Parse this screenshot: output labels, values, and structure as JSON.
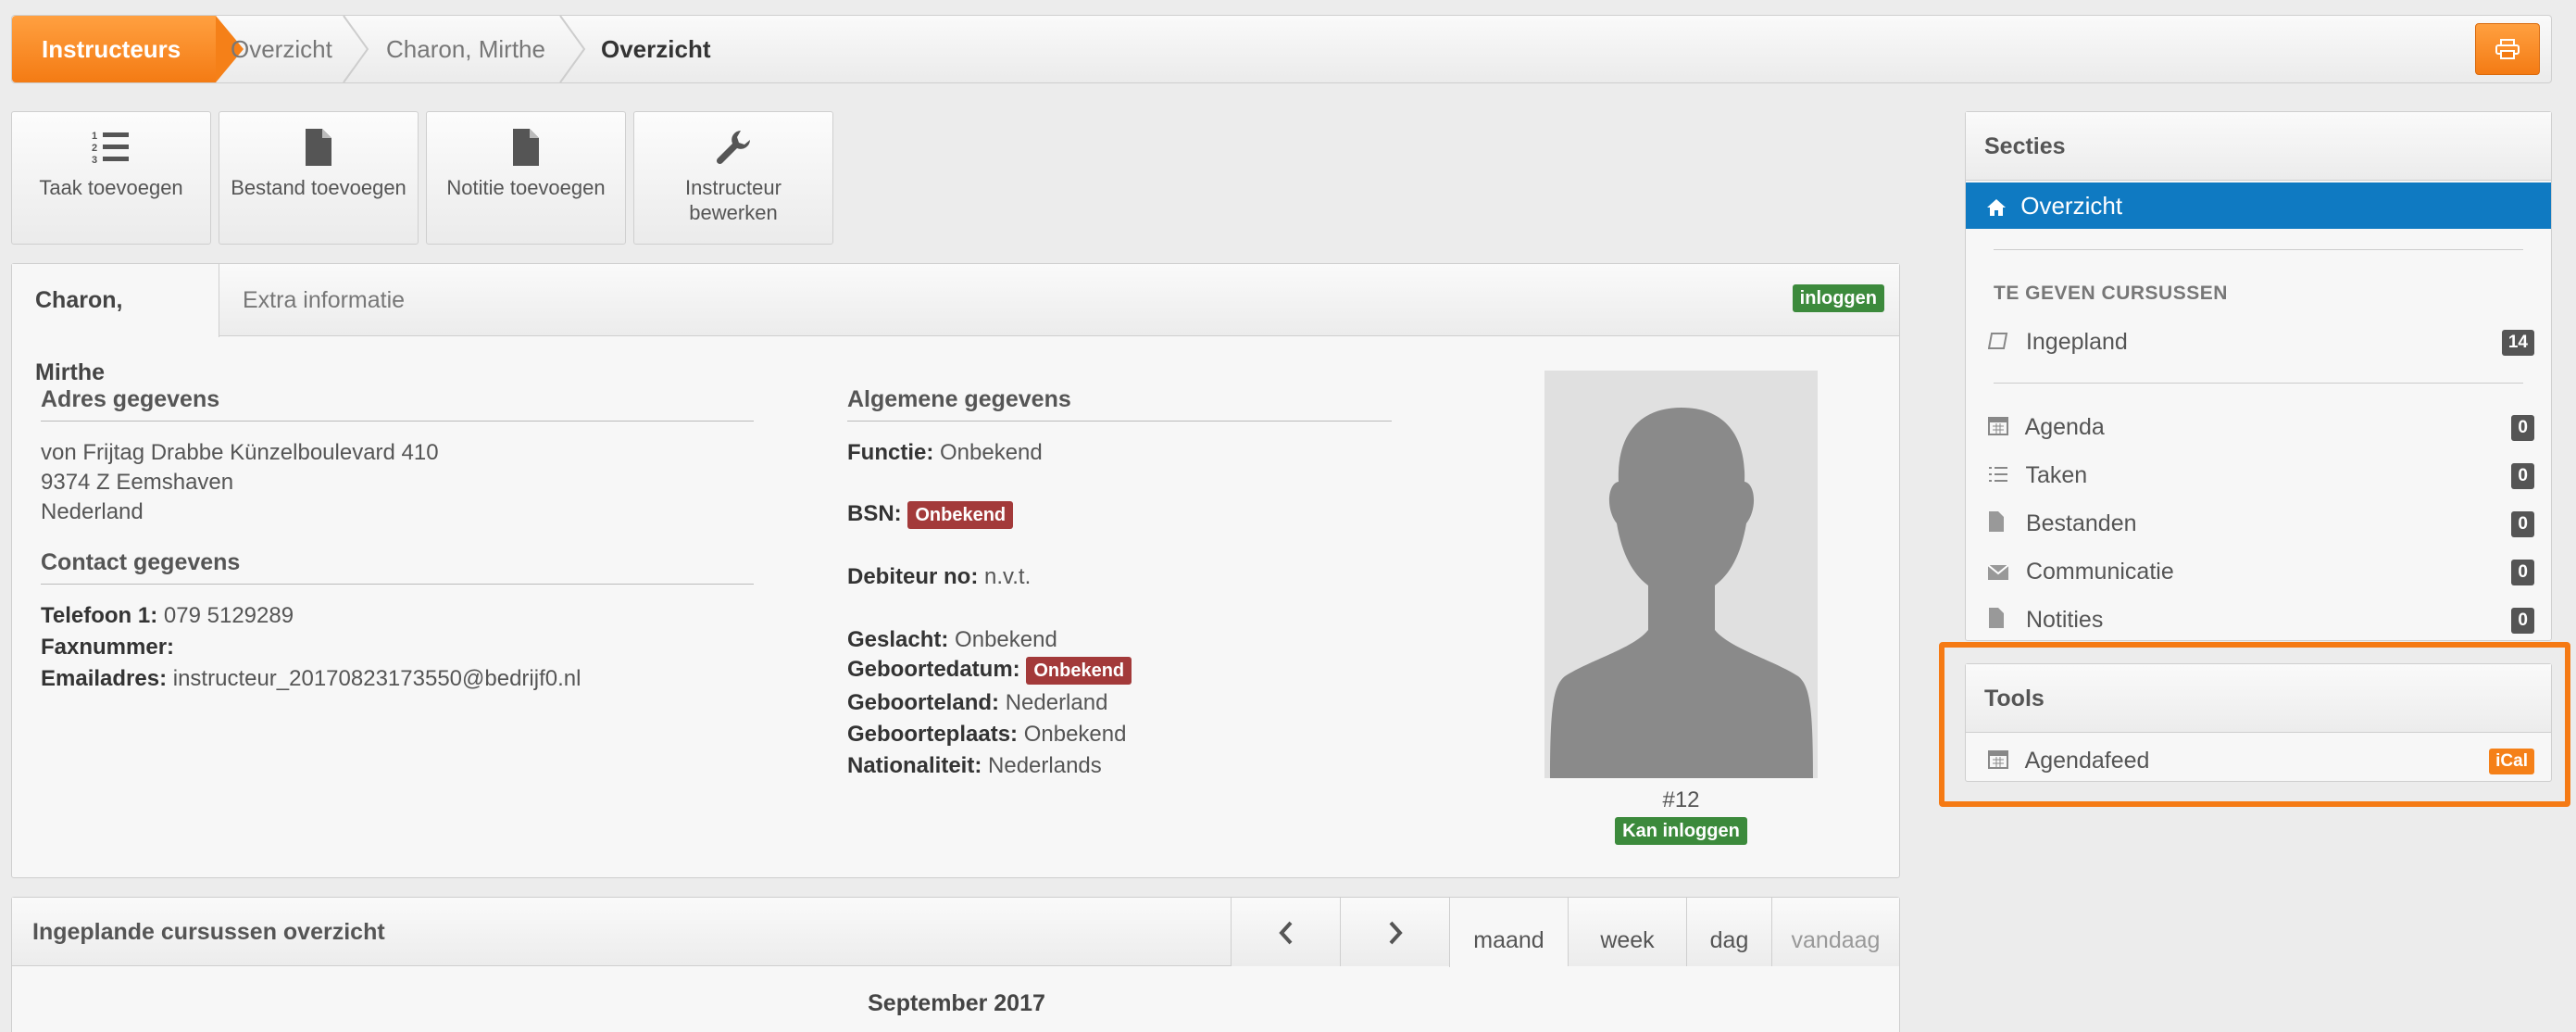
{
  "breadcrumb": {
    "items": [
      "Instructeurs",
      "Overzicht",
      "Charon, Mirthe",
      "Overzicht"
    ]
  },
  "toolbar": {
    "print_icon": "print-icon",
    "actions": [
      {
        "label": "Taak toevoegen",
        "icon": "ordered-list-icon"
      },
      {
        "label": "Bestand toevoegen",
        "icon": "file-icon"
      },
      {
        "label": "Notitie toevoegen",
        "icon": "file-icon"
      },
      {
        "label": "Instructeur bewerken",
        "icon": "wrench-icon"
      }
    ]
  },
  "profile": {
    "tabs": [
      "Charon, Mirthe",
      "Extra informatie"
    ],
    "login_badge": "inloggen",
    "address": {
      "title": "Adres gegevens",
      "lines": [
        "von Frijtag Drabbe Künzelboulevard 410",
        "9374 Z Eemshaven",
        "Nederland"
      ]
    },
    "contact": {
      "title": "Contact gegevens",
      "phone_label": "Telefoon 1:",
      "phone_value": "079 5129289",
      "fax_label": "Faxnummer:",
      "email_label": "Emailadres:",
      "email_value": "instructeur_20170823173550@bedrijf0.nl"
    },
    "general": {
      "title": "Algemene gegevens",
      "functie_label": "Functie:",
      "functie_value": "Onbekend",
      "bsn_label": "BSN:",
      "bsn_badge": "Onbekend",
      "debiteur_label": "Debiteur no:",
      "debiteur_value": "n.v.t.",
      "geslacht_label": "Geslacht:",
      "geslacht_value": "Onbekend",
      "geboortedatum_label": "Geboortedatum:",
      "geboortedatum_badge": "Onbekend",
      "geboorteland_label": "Geboorteland:",
      "geboorteland_value": "Nederland",
      "geboorteplaats_label": "Geboorteplaats:",
      "geboorteplaats_value": "Onbekend",
      "nationaliteit_label": "Nationaliteit:",
      "nationaliteit_value": "Nederlands"
    },
    "photo_id": "#12",
    "photo_badge": "Kan inloggen"
  },
  "calendar": {
    "title": "Ingeplande cursussen overzicht",
    "prev": "‹",
    "next": "›",
    "views": [
      "maand",
      "week",
      "dag",
      "vandaag"
    ],
    "month": "September 2017"
  },
  "sidebar": {
    "title": "Secties",
    "active": "Overzicht",
    "group_label": "TE GEVEN CURSUSSEN",
    "planned": {
      "label": "Ingepland",
      "count": "14"
    },
    "items": [
      {
        "label": "Agenda",
        "count": "0",
        "icon": "calendar-icon"
      },
      {
        "label": "Taken",
        "count": "0",
        "icon": "list-icon"
      },
      {
        "label": "Bestanden",
        "count": "0",
        "icon": "file-icon"
      },
      {
        "label": "Communicatie",
        "count": "0",
        "icon": "envelope-icon"
      },
      {
        "label": "Notities",
        "count": "0",
        "icon": "file-icon"
      }
    ]
  },
  "tools": {
    "title": "Tools",
    "item": {
      "label": "Agendafeed",
      "badge": "iCal",
      "icon": "calendar-icon"
    }
  },
  "colors": {
    "accent_orange": "#f58018",
    "active_blue": "#0f7ac2",
    "green": "#3c8a3c",
    "red": "#a33a3a"
  }
}
